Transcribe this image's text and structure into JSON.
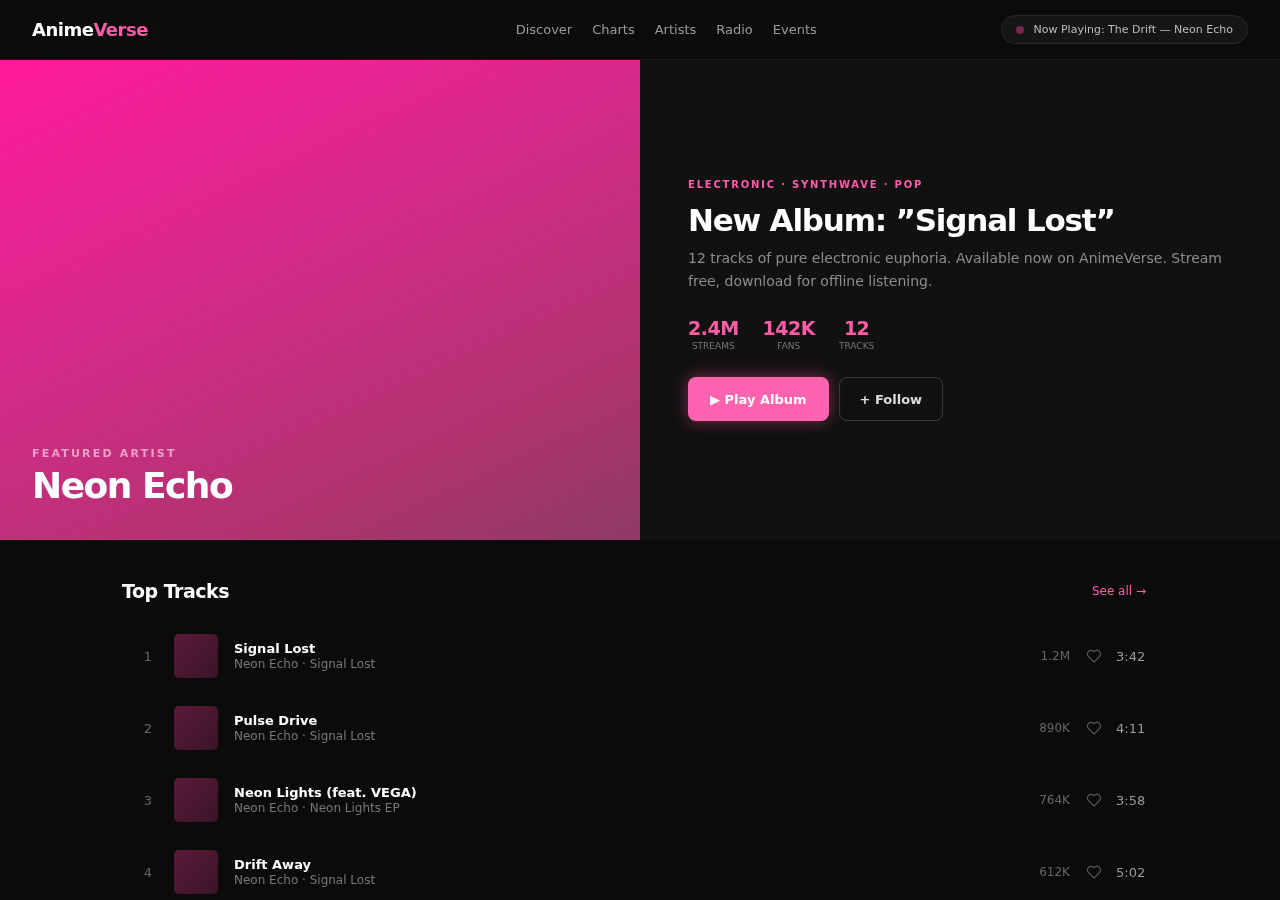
{
  "header": {
    "logo": {
      "first": "Anime",
      "second": "Verse"
    },
    "nav": [
      {
        "label": "Discover"
      },
      {
        "label": "Charts"
      },
      {
        "label": "Artists"
      },
      {
        "label": "Radio"
      },
      {
        "label": "Events"
      }
    ],
    "now_playing": "Now Playing: The Drift — Neon Echo"
  },
  "hero": {
    "eyebrow": "FEATURED ARTIST",
    "artist": "Neon Echo",
    "genres": "ELECTRONIC · SYNTHWAVE · POP",
    "title": "New Album: ”Signal Lost”",
    "description": "12 tracks of pure electronic euphoria. Available now on AnimeVerse. Stream free, download for offline listening.",
    "stats": [
      {
        "value": "2.4M",
        "label": "STREAMS"
      },
      {
        "value": "142K",
        "label": "FANS"
      },
      {
        "value": "12",
        "label": "TRACKS"
      }
    ],
    "buttons": [
      {
        "kind": "primary",
        "icon": "▶",
        "label": "Play Album"
      },
      {
        "kind": "secondary",
        "label": "+ Follow"
      }
    ]
  },
  "top_tracks": {
    "title": "Top Tracks",
    "see_all": "See all →",
    "tracks": [
      {
        "number": "1",
        "title": "Signal Lost",
        "subtitle": "Neon Echo · Signal Lost",
        "plays": "1.2M",
        "duration": "3:42"
      },
      {
        "number": "2",
        "title": "Pulse Drive",
        "subtitle": "Neon Echo · Signal Lost",
        "plays": "890K",
        "duration": "4:11"
      },
      {
        "number": "3",
        "title": "Neon Lights (feat. VEGA)",
        "subtitle": "Neon Echo · Neon Lights EP",
        "plays": "764K",
        "duration": "3:58"
      },
      {
        "number": "4",
        "title": "Drift Away",
        "subtitle": "Neon Echo · Signal Lost",
        "plays": "612K",
        "duration": "5:02"
      }
    ]
  }
}
